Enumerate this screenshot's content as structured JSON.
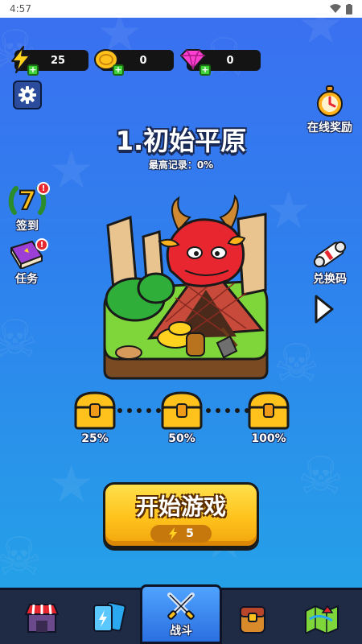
{
  "status_bar": {
    "time": "4:57"
  },
  "resources": [
    {
      "icon": "energy-icon",
      "value": "25",
      "color": "#ffd21f"
    },
    {
      "icon": "gold-coin-icon",
      "value": "0",
      "color": "#ffc21c"
    },
    {
      "icon": "gem-icon",
      "value": "0",
      "color": "#ff3fd0"
    }
  ],
  "level": {
    "title": "1.初始平原",
    "best_record": "最高记录：0%"
  },
  "left_menu": {
    "signin": {
      "label": "签到",
      "day": "7",
      "badge": "!"
    },
    "tasks": {
      "label": "任务",
      "badge": "!"
    }
  },
  "right_menu": {
    "online_reward": {
      "label": "在线奖励"
    },
    "redeem_code": {
      "label": "兑换码"
    }
  },
  "progress": {
    "chests": [
      {
        "label": "25%"
      },
      {
        "label": "50%"
      },
      {
        "label": "100%"
      }
    ]
  },
  "start_button": {
    "label": "开始游戏",
    "cost": "5"
  },
  "bottom_nav": {
    "tabs": [
      {
        "name": "shop-tab",
        "icon": "shop-icon"
      },
      {
        "name": "cards-tab",
        "icon": "cards-icon"
      },
      {
        "name": "battle-tab",
        "icon": "crossed-swords-icon",
        "label": "战斗",
        "active": true
      },
      {
        "name": "bag-tab",
        "icon": "backpack-icon"
      },
      {
        "name": "map-tab",
        "icon": "map-icon"
      }
    ]
  }
}
